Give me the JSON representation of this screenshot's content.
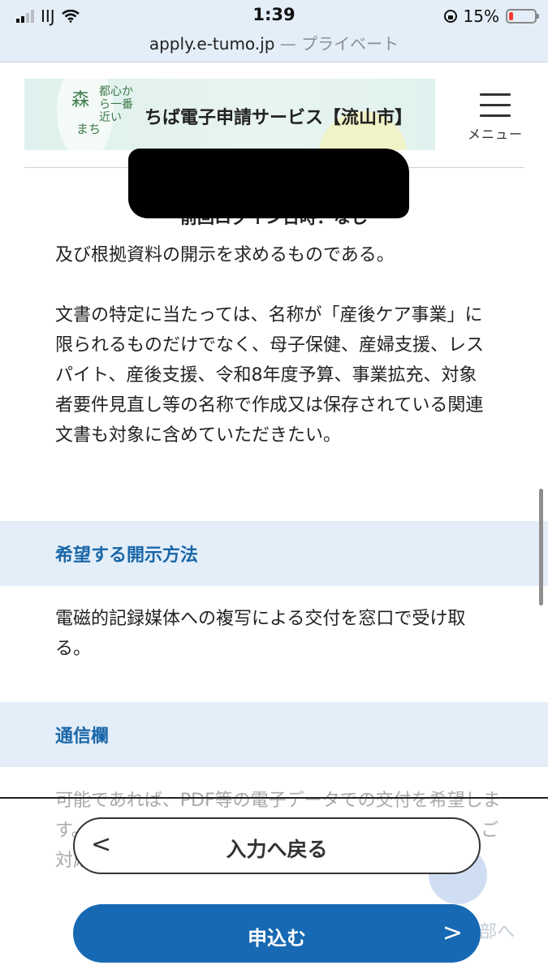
{
  "status_bar": {
    "carrier": "IIJ",
    "time": "1:39",
    "battery": "15%"
  },
  "browser": {
    "url": "apply.e-tumo.jp",
    "privacy": " — プライベート"
  },
  "header": {
    "logo_mori": "森",
    "logo_tagline": "都心から一番近い",
    "logo_machi": "まち",
    "service_title": "ちば電子申請サービス【流山市】",
    "menu_label": "メニュー"
  },
  "login": {
    "last_login": "前回ログイン日時：なし"
  },
  "content": {
    "para1": "及び根拠資料の開示を求めるものである。",
    "para2": "文書の特定に当たっては、名称が「産後ケア事業」に限られるものだけでなく、母子保健、産婦支援、レスパイト、産後支援、令和8年度予算、事業拡充、対象者要件見直し等の名称で作成又は保存されている関連文書も対象に含めていただきたい。",
    "section1_title": "希望する開示方法",
    "para3": "電磁的記録媒体への複写による交付を窓口で受け取る。",
    "section2_title": "通信欄",
    "para4": "可能であれば、PDF等の電子データでの交付を希望します。必要に応じて書面での交付でも構いませんので、ご対応いただけますと幸いです。"
  },
  "actions": {
    "back_label": "入力へ戻る",
    "apply_label": "申込む",
    "ghost_link": "部へ"
  }
}
